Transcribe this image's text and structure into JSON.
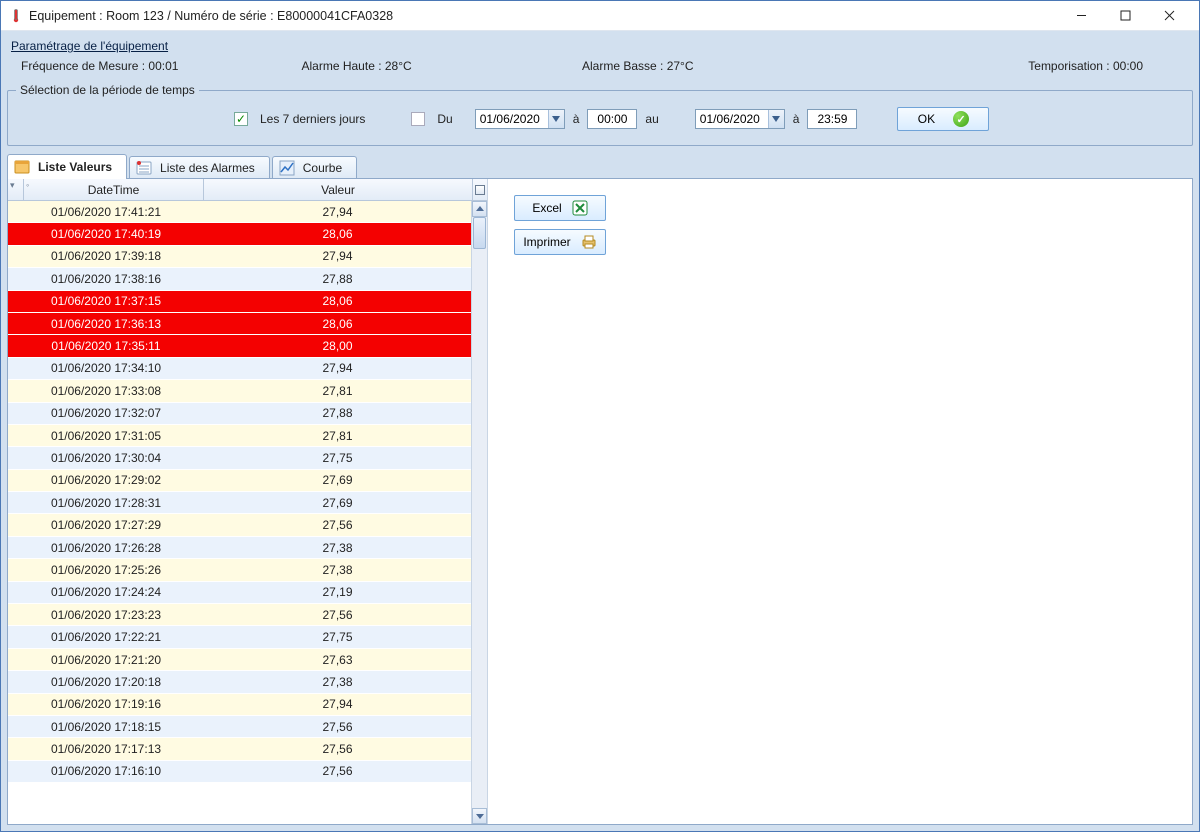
{
  "window": {
    "title": "Equipement : Room 123 / Numéro de série : E80000041CFA0328"
  },
  "params": {
    "heading": "Paramétrage de l'équipement",
    "frequency": "Fréquence de Mesure : 00:01",
    "alarm_high": "Alarme Haute : 28°C",
    "alarm_low": "Alarme Basse : 27°C",
    "delay": "Temporisation : 00:00"
  },
  "period": {
    "legend": "Sélection de la période de temps",
    "last7_label": "Les 7 derniers jours",
    "du_label": "Du",
    "a_label": "à",
    "au_label": "au",
    "date_from": "01/06/2020",
    "time_from": "00:00",
    "date_to": "01/06/2020",
    "time_to": "23:59",
    "ok_label": "OK"
  },
  "tabs": {
    "values": "Liste Valeurs",
    "alarms": "Liste des Alarmes",
    "curve": "Courbe"
  },
  "grid": {
    "col_datetime": "DateTime",
    "col_value": "Valeur",
    "rows": [
      {
        "dt": "01/06/2020 17:41:21",
        "v": "27,94",
        "cls": "cream"
      },
      {
        "dt": "01/06/2020 17:40:19",
        "v": "28,06",
        "cls": "alarm"
      },
      {
        "dt": "01/06/2020 17:39:18",
        "v": "27,94",
        "cls": "cream"
      },
      {
        "dt": "01/06/2020 17:38:16",
        "v": "27,88",
        "cls": "blue"
      },
      {
        "dt": "01/06/2020 17:37:15",
        "v": "28,06",
        "cls": "alarm"
      },
      {
        "dt": "01/06/2020 17:36:13",
        "v": "28,06",
        "cls": "alarm"
      },
      {
        "dt": "01/06/2020 17:35:11",
        "v": "28,00",
        "cls": "alarm"
      },
      {
        "dt": "01/06/2020 17:34:10",
        "v": "27,94",
        "cls": "blue"
      },
      {
        "dt": "01/06/2020 17:33:08",
        "v": "27,81",
        "cls": "cream"
      },
      {
        "dt": "01/06/2020 17:32:07",
        "v": "27,88",
        "cls": "blue"
      },
      {
        "dt": "01/06/2020 17:31:05",
        "v": "27,81",
        "cls": "cream"
      },
      {
        "dt": "01/06/2020 17:30:04",
        "v": "27,75",
        "cls": "blue"
      },
      {
        "dt": "01/06/2020 17:29:02",
        "v": "27,69",
        "cls": "cream"
      },
      {
        "dt": "01/06/2020 17:28:31",
        "v": "27,69",
        "cls": "blue"
      },
      {
        "dt": "01/06/2020 17:27:29",
        "v": "27,56",
        "cls": "cream"
      },
      {
        "dt": "01/06/2020 17:26:28",
        "v": "27,38",
        "cls": "blue"
      },
      {
        "dt": "01/06/2020 17:25:26",
        "v": "27,38",
        "cls": "cream"
      },
      {
        "dt": "01/06/2020 17:24:24",
        "v": "27,19",
        "cls": "blue"
      },
      {
        "dt": "01/06/2020 17:23:23",
        "v": "27,56",
        "cls": "cream"
      },
      {
        "dt": "01/06/2020 17:22:21",
        "v": "27,75",
        "cls": "blue"
      },
      {
        "dt": "01/06/2020 17:21:20",
        "v": "27,63",
        "cls": "cream"
      },
      {
        "dt": "01/06/2020 17:20:18",
        "v": "27,38",
        "cls": "blue"
      },
      {
        "dt": "01/06/2020 17:19:16",
        "v": "27,94",
        "cls": "cream"
      },
      {
        "dt": "01/06/2020 17:18:15",
        "v": "27,56",
        "cls": "blue"
      },
      {
        "dt": "01/06/2020 17:17:13",
        "v": "27,56",
        "cls": "cream"
      },
      {
        "dt": "01/06/2020 17:16:10",
        "v": "27,56",
        "cls": "blue"
      }
    ]
  },
  "actions": {
    "excel": "Excel",
    "print": "Imprimer"
  }
}
